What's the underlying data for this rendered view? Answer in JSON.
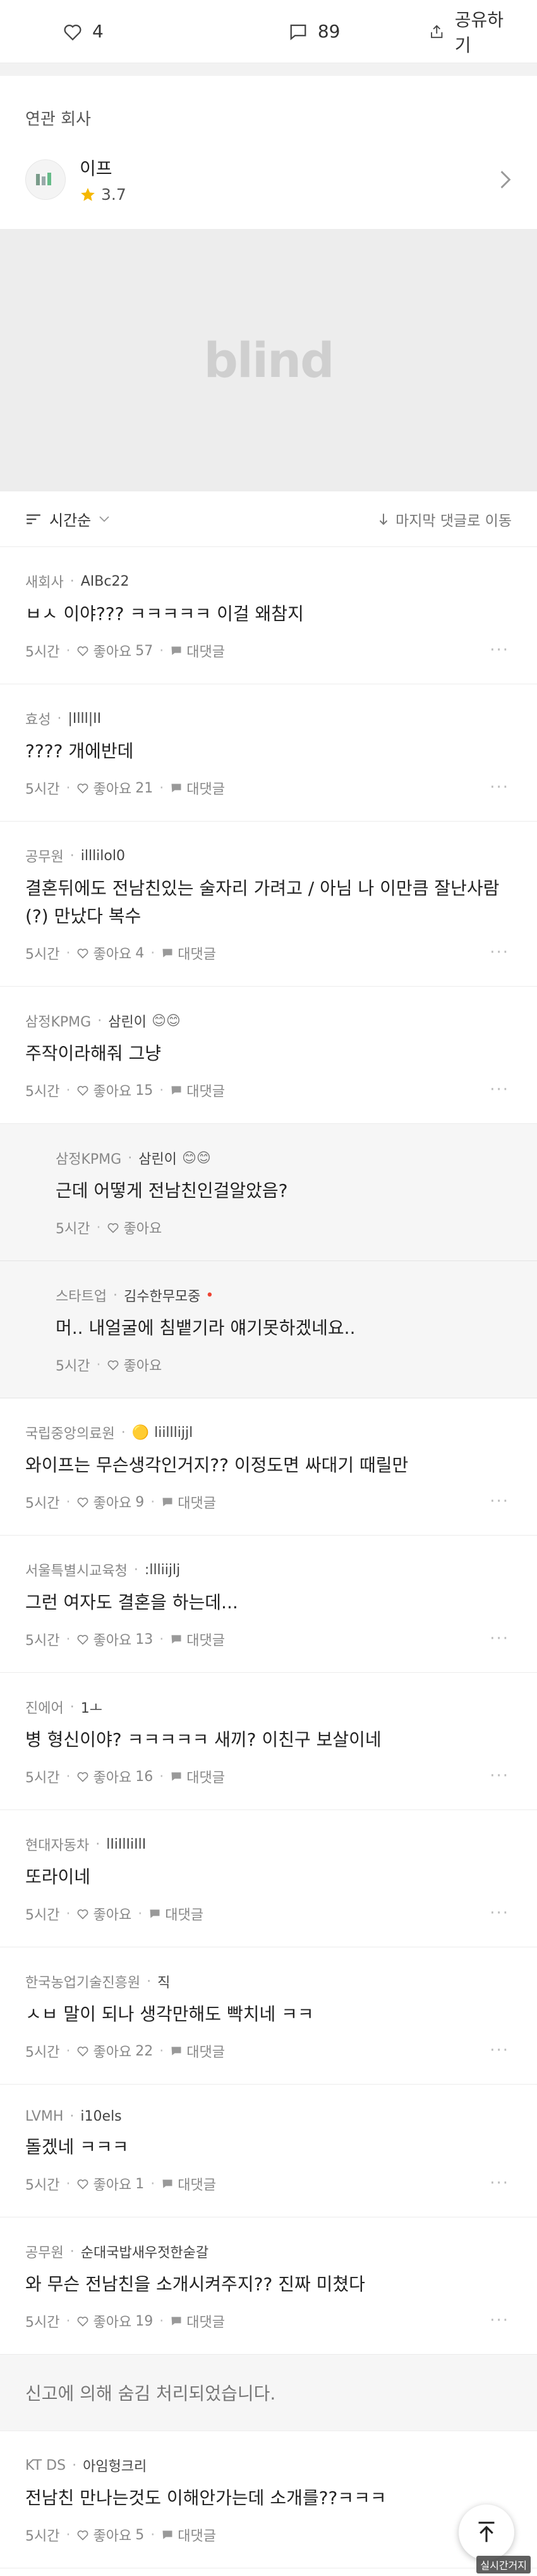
{
  "actions": {
    "likes": "4",
    "comments": "89",
    "share": "공유하기"
  },
  "company": {
    "label": "연관 회사",
    "name": "이프",
    "rating": "3.7"
  },
  "ad": {
    "word": "blind"
  },
  "sort": {
    "label": "시간순",
    "last": "마지막 댓글로 이동"
  },
  "footer_labels": {
    "like": "좋아요",
    "reply": "대댓글"
  },
  "comments": [
    {
      "company": "새회사",
      "nick": "AIBc22",
      "text": "ㅂㅅ 이야??? ㅋㅋㅋㅋㅋ 이걸 왜참지",
      "time": "5시간",
      "likes": "57"
    },
    {
      "company": "효성",
      "nick": "|Illl|II",
      "text": "???? 개에반데",
      "time": "5시간",
      "likes": "21"
    },
    {
      "company": "공무원",
      "nick": "illlilol0",
      "text": "결혼뒤에도 전남친있는 술자리 가려고 / 아님 나 이만큼 잘난사람(?) 만났다 복수",
      "time": "5시간",
      "likes": "4"
    },
    {
      "company": "삼정KPMG",
      "nick": "삼린이",
      "text": "주작이라해줘 그냥",
      "time": "5시간",
      "likes": "15"
    },
    {
      "company": "삼정KPMG",
      "nick": "삼린이",
      "text": "근데 어떻게 전남친인걸알았음?",
      "time": "5시간",
      "likes": ""
    },
    {
      "company": "스타트업",
      "nick": "김수한무모중",
      "text": "머.. 내얼굴에 침뱉기라 얘기못하겠네요..",
      "time": "5시간",
      "likes": ""
    },
    {
      "company": "국립중앙의료원",
      "nick": "liilllijjl",
      "text": "와이프는 무슨생각인거지?? 이정도면 싸대기 때릴만",
      "time": "5시간",
      "likes": "9"
    },
    {
      "company": "서울특별시교육청",
      "nick": ":llliijlj",
      "text": "그런 여자도 결혼을 하는데...",
      "time": "5시간",
      "likes": "13"
    },
    {
      "company": "진에어",
      "nick": "1ㅗ",
      "text": "병 형신이야? ㅋㅋㅋㅋㅋ 새끼? 이친구 보살이네",
      "time": "5시간",
      "likes": "16"
    },
    {
      "company": "현대자동차",
      "nick": "lIiIlIiIlI",
      "text": "또라이네",
      "time": "5시간",
      "likes": ""
    },
    {
      "company": "한국농업기술진흥원",
      "nick": "직",
      "text": "ㅅㅂ 말이 되나 생각만해도 빡치네 ㅋㅋ",
      "time": "5시간",
      "likes": "22"
    },
    {
      "company": "LVMH",
      "nick": "i10els",
      "text": "돌겠네 ㅋㅋㅋ",
      "time": "5시간",
      "likes": "1"
    },
    {
      "company": "공무원",
      "nick": "순대국밥새우젓한숟갈",
      "text": "와 무슨 전남친을 소개시켜주지?? 진짜 미쳤다",
      "time": "5시간",
      "likes": "19"
    },
    {
      "company": "KT DS",
      "nick": "아임헝크리",
      "text": "전남친 만나는것도 이해안가는데 소개를??ㅋㅋㅋ",
      "time": "5시간",
      "likes": "5"
    }
  ],
  "hidden_notice": "신고에 의해 숨김 처리되었습니다.",
  "watermark": "실시간거지"
}
